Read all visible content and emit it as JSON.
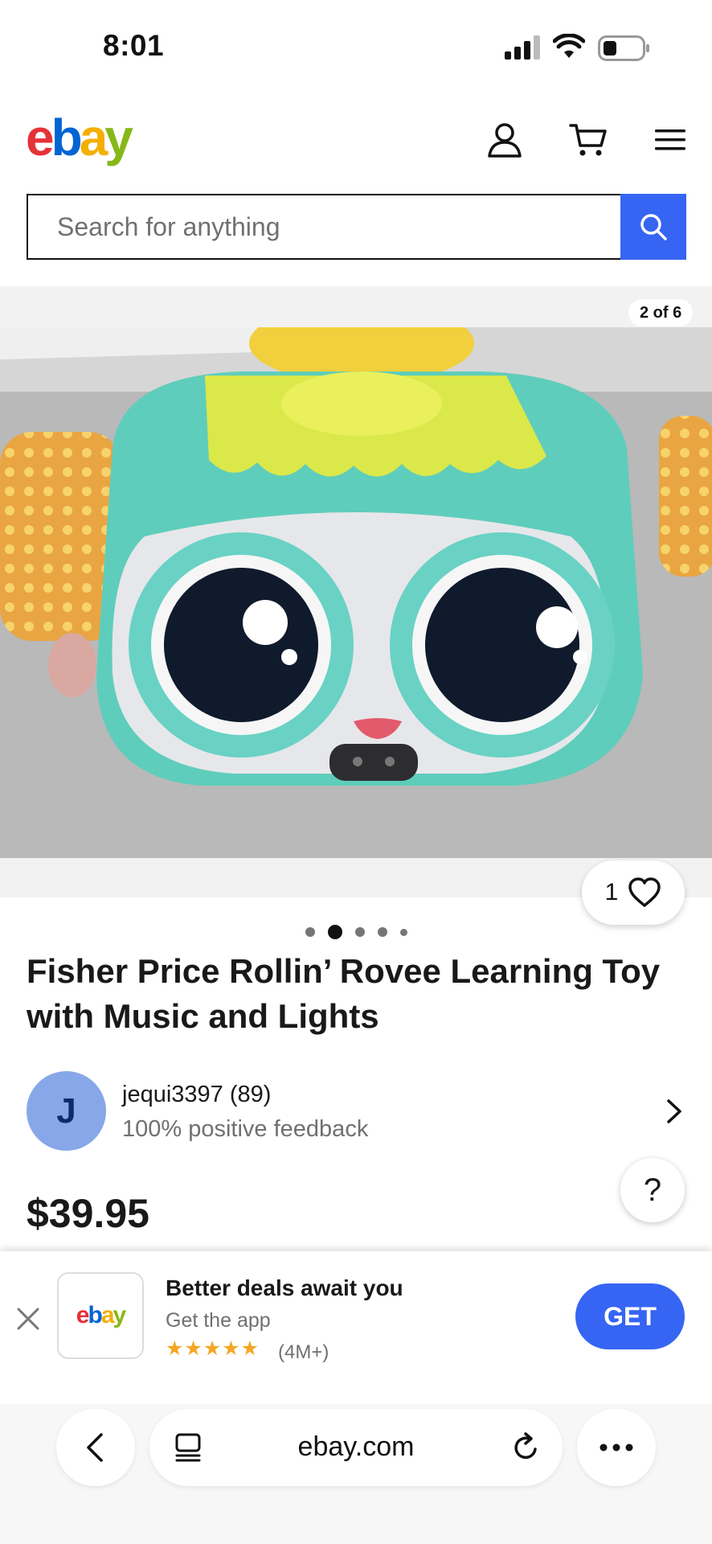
{
  "status_bar": {
    "time": "8:01"
  },
  "header": {
    "logo_letters": [
      "e",
      "b",
      "a",
      "y"
    ],
    "logo_colors": [
      "#e53238",
      "#0064d2",
      "#f5af02",
      "#86b817"
    ],
    "icons": [
      "account-icon",
      "cart-icon",
      "menu-icon"
    ]
  },
  "search": {
    "placeholder": "Search for anything",
    "button_icon": "search-icon"
  },
  "gallery": {
    "counter": "2 of 6",
    "watch_count": "1",
    "dots_total": 5,
    "dots_active_index": 1
  },
  "listing": {
    "title": "Fisher Price Rollin’ Rovee Learning Toy with Music and Lights",
    "seller": {
      "initial": "J",
      "name": "jequi3397 (89)",
      "feedback": "100% positive feedback"
    },
    "price": "$39.95",
    "help_label": "?"
  },
  "app_banner": {
    "app_logo": "ebay",
    "title": "Better deals await you",
    "subtitle": "Get the app",
    "stars": "★★★★★",
    "rating": "(4M+)",
    "get_label": "GET"
  },
  "browser": {
    "url": "ebay.com"
  }
}
